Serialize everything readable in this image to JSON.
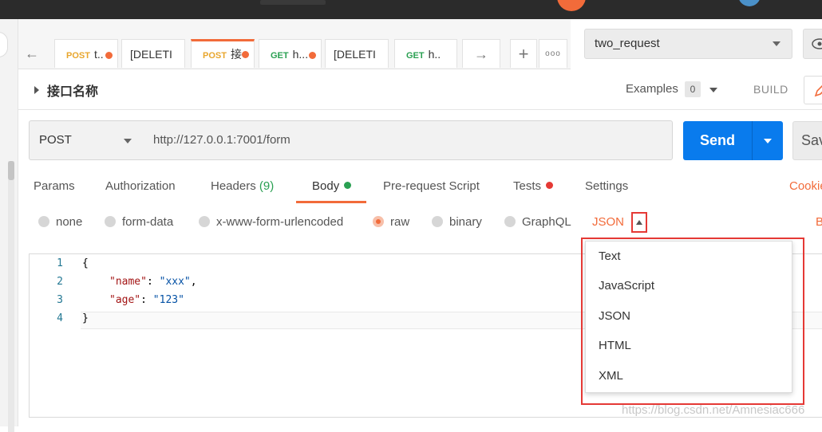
{
  "tabs": [
    {
      "method": "POST",
      "label": "t..",
      "dot": true
    },
    {
      "method": "",
      "label": "[DELETI",
      "dot": false
    },
    {
      "method": "POST",
      "label": "接",
      "dot": true,
      "active": true
    },
    {
      "method": "GET",
      "label": "h...",
      "dot": true
    },
    {
      "method": "",
      "label": "[DELETI",
      "dot": false
    },
    {
      "method": "GET",
      "label": "h..",
      "dot": false
    }
  ],
  "nav": {
    "back": "←",
    "forward": "→",
    "add": "+",
    "more": "ooo"
  },
  "environment": {
    "selected": "two_request"
  },
  "request": {
    "name": "接口名称",
    "examples_label": "Examples",
    "examples_count": "0",
    "build_label": "BUILD",
    "method": "POST",
    "url": "http://127.0.0.1:7001/form",
    "send_label": "Send",
    "save_label": "Save"
  },
  "req_tabs": {
    "params": "Params",
    "authorization": "Authorization",
    "headers": "Headers",
    "headers_count": "(9)",
    "body": "Body",
    "prerequest": "Pre-request Script",
    "tests": "Tests",
    "settings": "Settings",
    "cookies": "Cookies"
  },
  "body_types": {
    "none": "none",
    "form_data": "form-data",
    "urlencoded": "x-www-form-urlencoded",
    "raw": "raw",
    "binary": "binary",
    "graphql": "GraphQL",
    "format": "JSON",
    "beautify": "Beautify"
  },
  "editor": {
    "lines": [
      "1",
      "2",
      "3",
      "4"
    ],
    "open_brace": "{",
    "name_key": "\"name\"",
    "name_val": "\"xxx\"",
    "age_key": "\"age\"",
    "age_val": "\"123\"",
    "close_brace": "}"
  },
  "format_options": [
    "Text",
    "JavaScript",
    "JSON",
    "HTML",
    "XML"
  ],
  "watermark": "https://blog.csdn.net/Amnesiac666",
  "colors": {
    "accent": "#f26b3a",
    "send": "#097bed",
    "highlight_box": "#e53935"
  }
}
